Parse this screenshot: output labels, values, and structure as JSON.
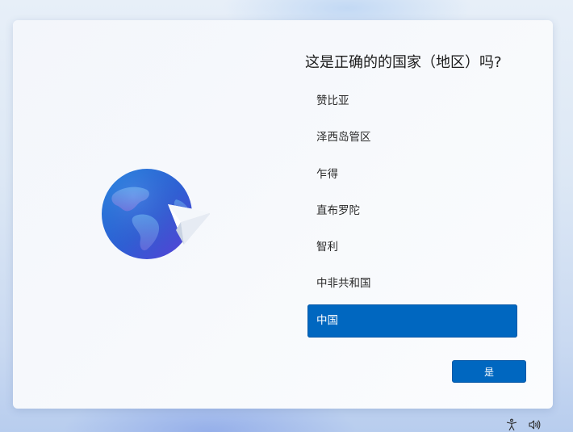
{
  "dialog": {
    "title": "这是正确的的国家（地区）吗?",
    "countries": [
      {
        "label": "赞比亚",
        "selected": false
      },
      {
        "label": "泽西岛管区",
        "selected": false
      },
      {
        "label": "乍得",
        "selected": false
      },
      {
        "label": "直布罗陀",
        "selected": false
      },
      {
        "label": "智利",
        "selected": false
      },
      {
        "label": "中非共和国",
        "selected": false
      },
      {
        "label": "中国",
        "selected": true
      }
    ],
    "confirm_label": "是"
  },
  "illustration": {
    "icon": "globe-paper-plane-icon"
  },
  "tray": {
    "icons": [
      "accessibility-icon",
      "volume-icon"
    ]
  },
  "colors": {
    "accent": "#0067c0",
    "card_bg": "#f5f8fc",
    "text": "#1b1b1b"
  }
}
